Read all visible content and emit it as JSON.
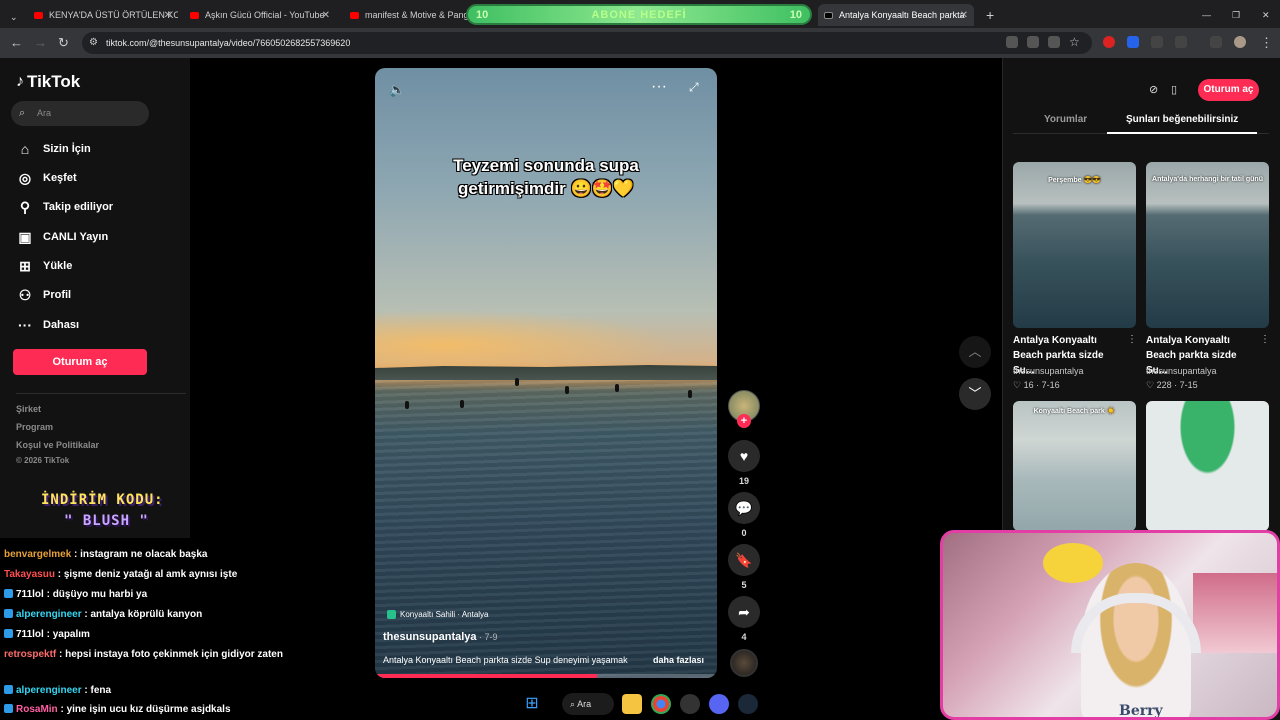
{
  "browser": {
    "tabs": [
      {
        "title": "KENYA'DA ÜSTÜ ÖRTÜLEN KO"
      },
      {
        "title": "Aşkın Gücü Official - YouTube"
      },
      {
        "title": "manifest & Motive & Pango"
      },
      {
        "title": "Antalya Konyaaltı Beach parkta"
      }
    ],
    "url": "tiktok.com/@thesunsupantalya/video/7660502682557369620",
    "new_tab": "+",
    "overlay_goal": {
      "left": "10",
      "label": "ABONE HEDEFİ",
      "right": "10"
    }
  },
  "tiktok": {
    "logo": "TikTok",
    "search_placeholder": "Ara",
    "nav": [
      {
        "label": "Sizin İçin",
        "icon": "home-icon"
      },
      {
        "label": "Keşfet",
        "icon": "compass-icon"
      },
      {
        "label": "Takip ediliyor",
        "icon": "following-icon"
      },
      {
        "label": "CANLI Yayın",
        "icon": "live-icon"
      },
      {
        "label": "Yükle",
        "icon": "upload-icon"
      },
      {
        "label": "Profil",
        "icon": "profile-icon"
      },
      {
        "label": "Dahası",
        "icon": "more-icon"
      }
    ],
    "login": "Oturum aç",
    "footer": [
      "Şirket",
      "Program",
      "Koşul ve Politikalar",
      "© 2026 TikTok"
    ],
    "video": {
      "caption": "Teyzemi  sonunda supa getirmişimdir 😀🤩💛",
      "location": "Konyaaltı Sahili · Antalya",
      "author": "thesunsupantalya",
      "date": " · 7-9",
      "description": "Antalya Konyaaltı Beach parkta sizde Sup deneyimi yaşamak",
      "more": "daha fazlası",
      "progress_fraction": 0.65
    },
    "actions": {
      "likes": "19",
      "comments": "0",
      "saves": "5",
      "shares": "4"
    },
    "right_panel": {
      "tabs": [
        "Yorumlar",
        "Şunları beğenebilirsiniz"
      ],
      "login": "Oturum aç",
      "videos": [
        {
          "overlay": "Perşembe 😎😎",
          "title": "Antalya Konyaaltı Beach parkta sizde Su...",
          "user": "thesunsupantalya",
          "likes": "16",
          "date": "7-16"
        },
        {
          "overlay": "Antalya'da herhangi bir tatil günü",
          "title": "Antalya Konyaaltı Beach parkta sizde Su...",
          "user": "thesunsupantalya",
          "likes": "228",
          "date": "7-15"
        },
        {
          "overlay": "Konyaaltı Beach park ☀️",
          "title": "",
          "user": "",
          "likes": "",
          "date": ""
        },
        {
          "overlay": "",
          "title": "",
          "user": "",
          "likes": "",
          "date": ""
        }
      ]
    }
  },
  "stream": {
    "promo_line1": "İNDİRİM KODU:",
    "promo_line2": "\" BLUSH \"",
    "chat": [
      {
        "user": "benvargelmek",
        "text": "instagram ne olacak başka",
        "color": "#e8a13a",
        "badge": false
      },
      {
        "user": "Takayasuu",
        "text": "şişme deniz yatağı al amk aynısı işte",
        "color": "#ff4f4f",
        "badge": false
      },
      {
        "user": "711lol",
        "text": "düşüyo mu harbi ya",
        "color": "#ffffff",
        "badge": true
      },
      {
        "user": "alperengineer",
        "text": "antalya köprülü kanyon",
        "color": "#35d6f2",
        "badge": true
      },
      {
        "user": "711lol",
        "text": "yapalım",
        "color": "#ffffff",
        "badge": true
      },
      {
        "user": "retrospektf",
        "text": "hepsi instaya foto çekinmek için gidiyor zaten",
        "color": "#ff6b6b",
        "badge": false
      },
      {
        "user": "alperengineer",
        "text": "fena",
        "color": "#35d6f2",
        "badge": true
      },
      {
        "user": "RosaMin",
        "text": "yine işin ucu kız düşürme asjdkals",
        "color": "#ff5fa3",
        "badge": true
      }
    ],
    "webcam_shirt": "Berry"
  },
  "taskbar": {
    "search": "Ara"
  }
}
